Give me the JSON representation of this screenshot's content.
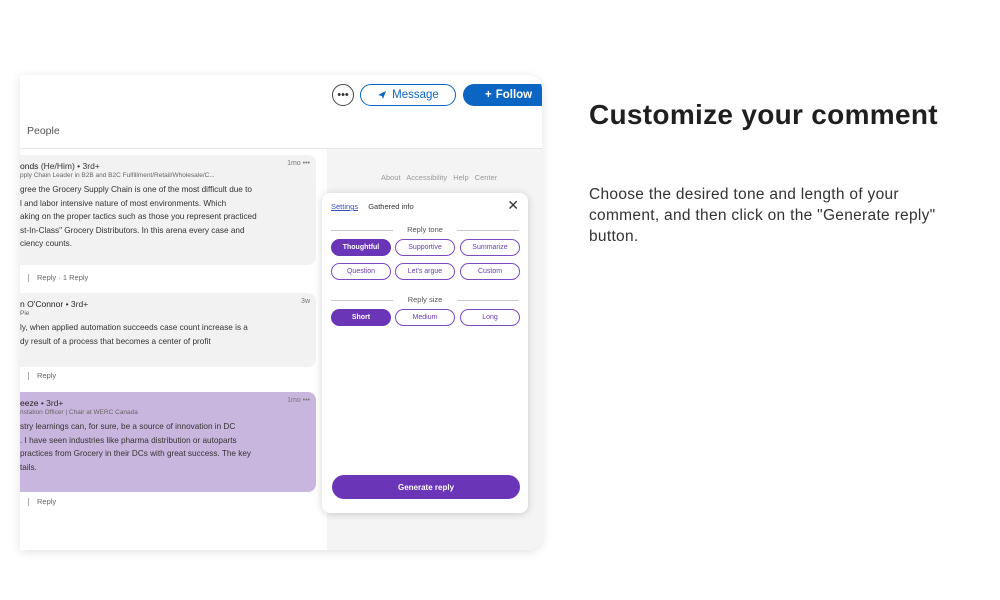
{
  "header": {
    "more_icon": "ellipsis-icon",
    "message_label": "Message",
    "follow_label": "Follow",
    "subnav_label": "People"
  },
  "comments": [
    {
      "name": "onds",
      "meta": "(He/Him) • 3rd+",
      "subtitle": "pply Chain Leader in B2B and B2C Fulfillment/Retail/Wholesale/C...",
      "time": "1mo",
      "lines": [
        "gree the Grocery Supply Chain is one of the most difficult due to",
        "l and labor intensive nature of most environments. Which",
        "aking on the proper tactics such as those you represent practiced",
        "st-In-Class\" Grocery Distributors. In this arena every case and",
        "ciency counts."
      ],
      "actions": [
        "Reply",
        "1 Reply"
      ]
    },
    {
      "name": "n O'Connor",
      "meta": "• 3rd+",
      "subtitle": "Pie",
      "time": "3w",
      "lines": [
        "ly, when applied automation succeeds case count increase is a",
        "dy result of a process that becomes a center of profit"
      ],
      "actions": [
        "Reply"
      ]
    },
    {
      "name": "eeze",
      "meta": "• 3rd+",
      "subtitle": "nstation Officer | Chair at WERC Canada",
      "time": "1mo",
      "lines": [
        "stry learnings can, for sure, be a source of innovation in DC",
        ". I have seen industries like pharma distribution or autoparts",
        "practices from Grocery in their DCs with great success. The key",
        "tails."
      ],
      "actions": [
        "Reply"
      ]
    }
  ],
  "sidebar": {
    "links": "About Accessibility Help Center"
  },
  "panel": {
    "tab_settings": "Settings",
    "tab_info": "Gathered info",
    "close_icon": "close-icon",
    "tone_label": "Reply tone",
    "tones": [
      "Thoughtful",
      "Supportive",
      "Summarize",
      "Question",
      "Let's argue",
      "Custom"
    ],
    "tone_selected": "Thoughtful",
    "size_label": "Reply size",
    "sizes": [
      "Short",
      "Medium",
      "Long"
    ],
    "size_selected": "Short",
    "generate_label": "Generate reply"
  },
  "promo": {
    "heading": "Customize your comment",
    "description": "Choose the desired tone and length of your comment, and then click on the \"Generate reply\" button."
  },
  "colors": {
    "linkedin_blue": "#0a66c2",
    "accent_purple": "#6a35b7",
    "highlight_purple": "#c9b6de"
  }
}
